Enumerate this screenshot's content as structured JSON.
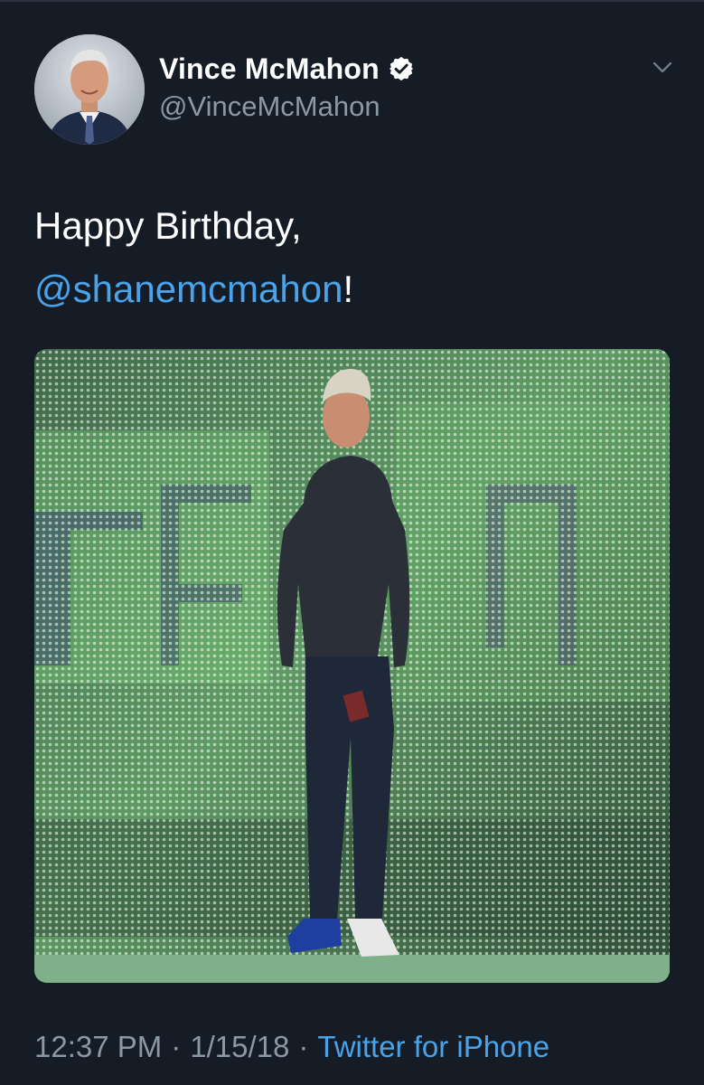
{
  "tweet": {
    "author": {
      "display_name": "Vince McMahon",
      "handle": "@VinceMcMahon",
      "verified": true
    },
    "text_line1": "Happy Birthday,",
    "mention": "@shanemcmahon",
    "text_suffix": "!",
    "meta": {
      "time": "12:37 PM",
      "separator": "·",
      "date": "1/15/18",
      "source": "Twitter for iPhone"
    }
  },
  "icons": {
    "verified": "verified-badge-icon",
    "menu": "chevron-down-icon"
  },
  "colors": {
    "background": "#151c26",
    "text": "#ffffff",
    "secondary_text": "#8b98a5",
    "link": "#4aa3e8"
  }
}
